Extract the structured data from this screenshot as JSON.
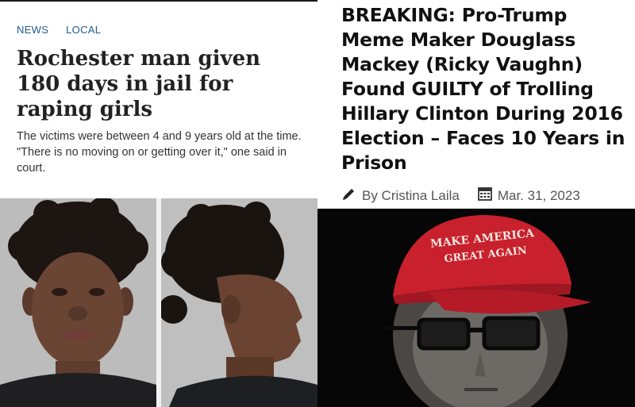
{
  "left_article": {
    "tags": [
      "NEWS",
      "LOCAL"
    ],
    "headline": "Rochester man given 180 days in jail for raping girls",
    "summary": "The victims were between 4 and 9 years old at the time. \"There is no moving on or getting over it,\" one said in court."
  },
  "right_article": {
    "headline": "BREAKING: Pro-Trump Meme Maker Douglass Mackey (Ricky Vaughn) Found GUILTY of Trolling Hillary Clinton During 2016 Election – Faces 10 Years in Prison",
    "author": "By Cristina Laila",
    "date": "Mar. 31, 2023",
    "icons": [
      "pen-icon",
      "calendar-icon"
    ]
  },
  "photos": {
    "maga_hat_text": [
      "MAKE AMERICA",
      "GREAT AGAIN"
    ]
  },
  "colors": {
    "tag_link": "#1f5c8b",
    "headline": "#222222",
    "hat_red": "#c8202c",
    "background": "#ffffff"
  }
}
